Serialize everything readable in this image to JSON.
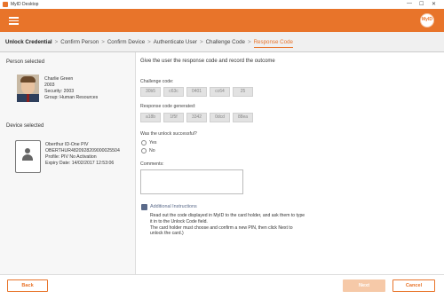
{
  "window": {
    "title": "MyID Desktop",
    "minimize": "—",
    "maximize": "☐",
    "close": "✕"
  },
  "header": {
    "menu_icon": "hamburger-icon",
    "logo_text": "MyID",
    "accent": "#e8742a"
  },
  "breadcrumb": {
    "items": [
      "Unlock Credential",
      "Confirm Person",
      "Confirm Device",
      "Authenticate User",
      "Challenge Code",
      "Response Code"
    ],
    "separator": ">",
    "active_index": 5
  },
  "person": {
    "section_title": "Person selected",
    "name": "Charlie Green",
    "id": "2003",
    "security": "Security: 2003",
    "group": "Group: Human Resources"
  },
  "device": {
    "section_title": "Device selected",
    "name": "Oberthur ID-One PIV",
    "serial": "OBERTHUR4820928209000025504",
    "profile": "Profile:  PIV No Activation",
    "expiry": "Expiry Date:  14/02/2017 12:53:06"
  },
  "main": {
    "heading": "Give the user the response code and record the outcome",
    "challenge_label": "Challenge code:",
    "challenge_codes": [
      "30b5",
      "c63c",
      "0401",
      "cc64",
      "25"
    ],
    "response_label": "Response code generated:",
    "response_codes": [
      "a18b",
      "1f5f",
      "3342",
      "0dcd",
      "88ea"
    ],
    "question": "Was the unlock successful?",
    "options": [
      "Yes",
      "No"
    ],
    "comments_label": "Comments:",
    "comments_value": "",
    "instructions_title": "Additional Instructions",
    "instructions_text": "Read out the code displayed in MyID to the card holder, and ask them to type it in to the Unlock Code field.\nThe card holder must choose and confirm a new PIN, then click Next to unlock the card.)"
  },
  "footer": {
    "back_label": "Back",
    "next_label": "Next",
    "cancel_label": "Cancel"
  }
}
